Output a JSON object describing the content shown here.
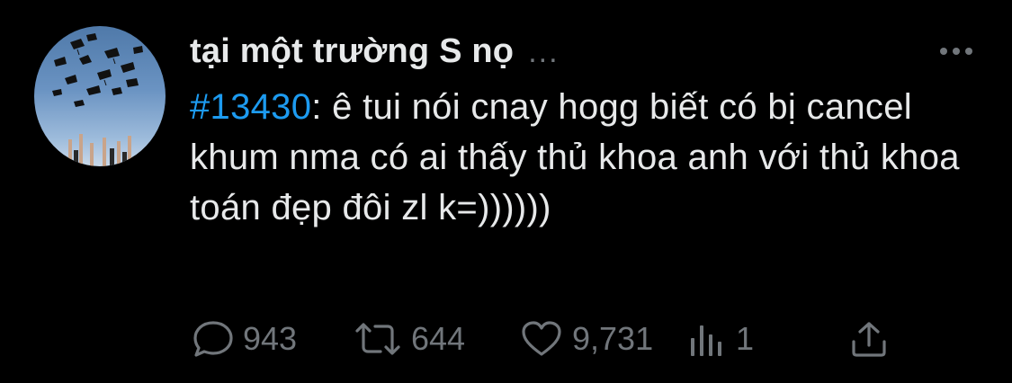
{
  "tweet": {
    "display_name": "tại một trường S nọ",
    "header_ellipsis": "...",
    "hashtag": "#13430",
    "text": ": ê tui nói cnay hogg biết có bị cancel khum nma có ai thấy thủ khoa anh với thủ khoa toán đẹp đôi zl k=))))))",
    "hashtag_color": "#1d9bf0"
  },
  "actions": {
    "reply": {
      "icon": "reply-icon",
      "count": "943"
    },
    "retweet": {
      "icon": "retweet-icon",
      "count": "644"
    },
    "like": {
      "icon": "heart-icon",
      "count": "9,731"
    },
    "analytics": {
      "icon": "analytics-icon",
      "count": "1"
    },
    "share": {
      "icon": "share-icon"
    }
  },
  "colors": {
    "background": "#000000",
    "text": "#e7e9ea",
    "secondary": "#71767b"
  }
}
